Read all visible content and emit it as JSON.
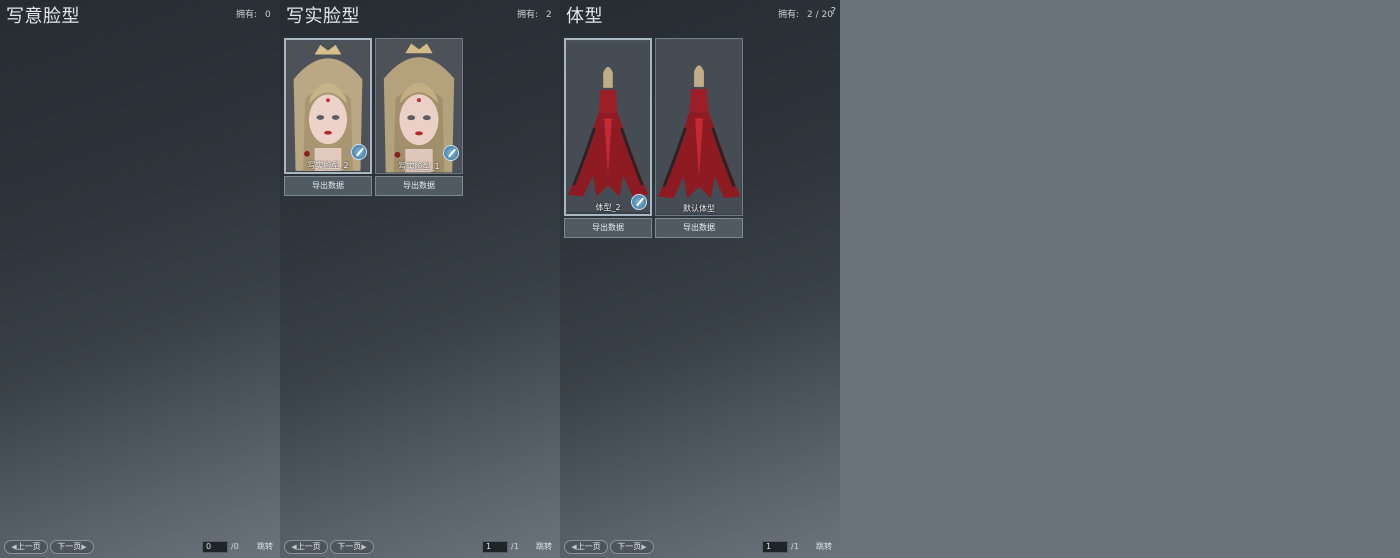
{
  "panels": {
    "xieyi": {
      "title": "写意脸型",
      "owned_label": "拥有:",
      "owned_value": "0",
      "prev_label": "上一页",
      "next_label": "下一页",
      "page_current": "0",
      "page_total": "/0",
      "jump_label": "跳转"
    },
    "xieshi": {
      "title": "写实脸型",
      "owned_label": "拥有:",
      "owned_value": "2",
      "cards": [
        {
          "name": "写实脸型_2",
          "export_label": "导出数据"
        },
        {
          "name": "写实脸型_1",
          "export_label": "导出数据"
        }
      ],
      "prev_label": "上一页",
      "next_label": "下一页",
      "page_current": "1",
      "page_total": "/1",
      "jump_label": "跳转"
    },
    "tixing": {
      "title": "体型",
      "owned_label": "拥有:",
      "owned_value": "2 / 20",
      "help": "?",
      "cards": [
        {
          "name": "体型_2",
          "export_label": "导出数据"
        },
        {
          "name": "默认体型",
          "export_label": "导出数据"
        }
      ],
      "prev_label": "上一页",
      "next_label": "下一页",
      "page_current": "1",
      "page_total": "/1",
      "jump_label": "跳转"
    }
  },
  "icons": {
    "edit": "edit-brush-icon",
    "prev": "chevron-left-icon",
    "next": "chevron-right-icon",
    "help": "help-icon"
  },
  "colors": {
    "panel_dark": "#262c32",
    "panel_light": "#6b737c",
    "button": "#4f5a63",
    "accent": "#7fb8dc"
  }
}
